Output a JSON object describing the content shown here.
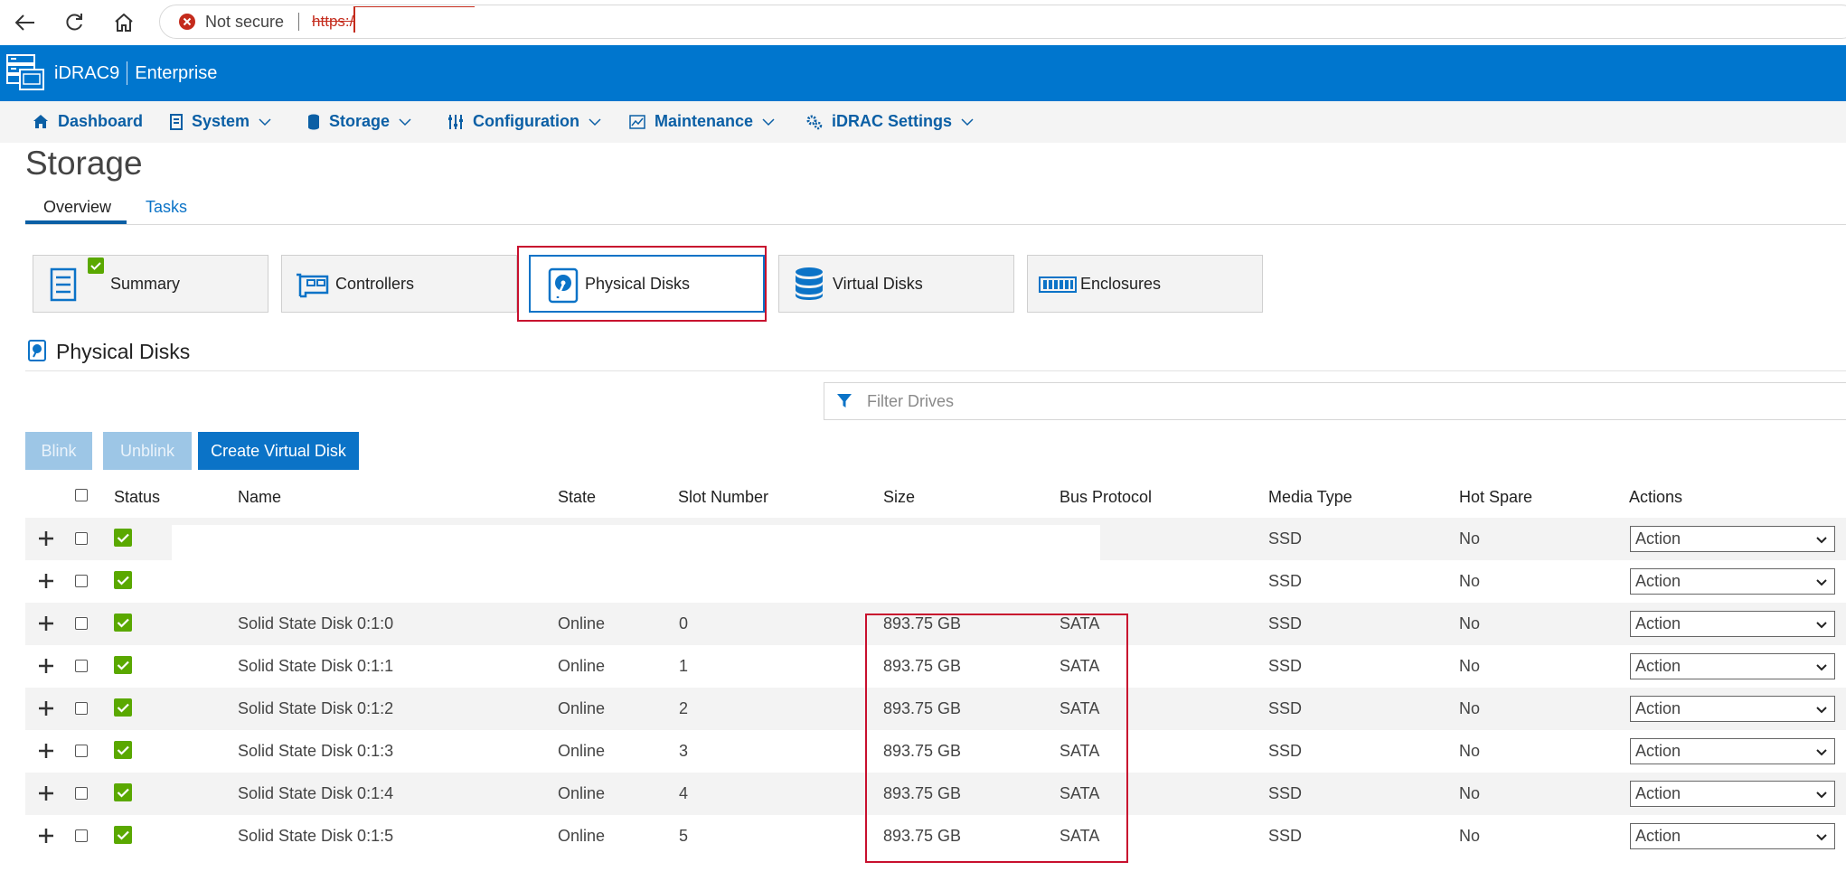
{
  "browser": {
    "security_label": "Not secure",
    "url_scheme": "https:/"
  },
  "header": {
    "product": "iDRAC9",
    "edition": "Enterprise",
    "brand_color": "#0076ce"
  },
  "menu": {
    "items": [
      {
        "label": "Dashboard",
        "icon": "home-icon"
      },
      {
        "label": "System",
        "icon": "server-icon"
      },
      {
        "label": "Storage",
        "icon": "database-icon"
      },
      {
        "label": "Configuration",
        "icon": "sliders-icon"
      },
      {
        "label": "Maintenance",
        "icon": "chart-icon"
      },
      {
        "label": "iDRAC Settings",
        "icon": "gears-icon"
      }
    ]
  },
  "page": {
    "title": "Storage",
    "tabs": [
      {
        "label": "Overview",
        "active": true
      },
      {
        "label": "Tasks",
        "active": false
      }
    ]
  },
  "cards": [
    {
      "label": "Summary",
      "icon": "summary-icon",
      "status": "ok"
    },
    {
      "label": "Controllers",
      "icon": "controller-card-icon"
    },
    {
      "label": "Physical Disks",
      "icon": "physical-disk-icon",
      "selected": true
    },
    {
      "label": "Virtual Disks",
      "icon": "virtual-disk-icon"
    },
    {
      "label": "Enclosures",
      "icon": "enclosure-icon"
    }
  ],
  "section": {
    "title": "Physical Disks",
    "filter_placeholder": "Filter Drives"
  },
  "buttons": {
    "blink": "Blink",
    "unblink": "Unblink",
    "create_virtual_disk": "Create Virtual Disk"
  },
  "table": {
    "columns": [
      "Status",
      "Name",
      "State",
      "Slot Number",
      "Size",
      "Bus Protocol",
      "Media Type",
      "Hot Spare",
      "Actions"
    ],
    "rows": [
      {
        "status": "ok",
        "name": "",
        "state": "",
        "slot": "",
        "size": "",
        "bus": "",
        "media": "SSD",
        "hot_spare": "No",
        "action": "Action"
      },
      {
        "status": "ok",
        "name": "",
        "state": "",
        "slot": "",
        "size": "",
        "bus": "",
        "media": "SSD",
        "hot_spare": "No",
        "action": "Action"
      },
      {
        "status": "ok",
        "name": "Solid State Disk 0:1:0",
        "state": "Online",
        "slot": "0",
        "size": "893.75 GB",
        "bus": "SATA",
        "media": "SSD",
        "hot_spare": "No",
        "action": "Action"
      },
      {
        "status": "ok",
        "name": "Solid State Disk 0:1:1",
        "state": "Online",
        "slot": "1",
        "size": "893.75 GB",
        "bus": "SATA",
        "media": "SSD",
        "hot_spare": "No",
        "action": "Action"
      },
      {
        "status": "ok",
        "name": "Solid State Disk 0:1:2",
        "state": "Online",
        "slot": "2",
        "size": "893.75 GB",
        "bus": "SATA",
        "media": "SSD",
        "hot_spare": "No",
        "action": "Action"
      },
      {
        "status": "ok",
        "name": "Solid State Disk 0:1:3",
        "state": "Online",
        "slot": "3",
        "size": "893.75 GB",
        "bus": "SATA",
        "media": "SSD",
        "hot_spare": "No",
        "action": "Action"
      },
      {
        "status": "ok",
        "name": "Solid State Disk 0:1:4",
        "state": "Online",
        "slot": "4",
        "size": "893.75 GB",
        "bus": "SATA",
        "media": "SSD",
        "hot_spare": "No",
        "action": "Action"
      },
      {
        "status": "ok",
        "name": "Solid State Disk 0:1:5",
        "state": "Online",
        "slot": "5",
        "size": "893.75 GB",
        "bus": "SATA",
        "media": "SSD",
        "hot_spare": "No",
        "action": "Action"
      }
    ]
  }
}
